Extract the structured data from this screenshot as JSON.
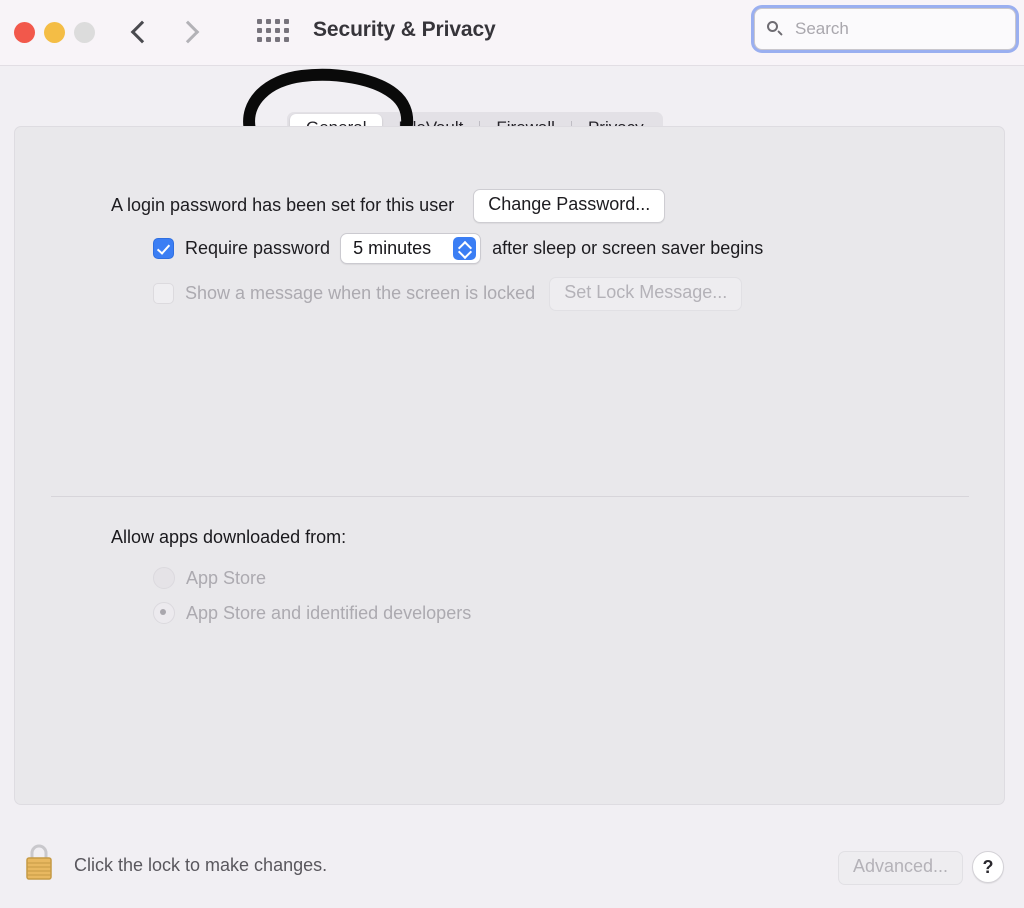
{
  "window": {
    "title": "Security & Privacy",
    "traffic_lights": [
      {
        "name": "close",
        "color": "#f2584b"
      },
      {
        "name": "minimize",
        "color": "#f4bd45"
      },
      {
        "name": "zoom",
        "color": "#dcdcdc"
      }
    ],
    "nav": {
      "back_icon": "chevron-left-icon",
      "forward_icon": "chevron-right-icon"
    },
    "grid_icon": "show-all-grid-icon"
  },
  "search": {
    "placeholder": "Search",
    "value": "",
    "icon": "search-icon",
    "focus_ring_color": "#9aaff0"
  },
  "tabs": [
    {
      "label": "General",
      "selected": true
    },
    {
      "label": "FileVault",
      "selected": false
    },
    {
      "label": "Firewall",
      "selected": false
    },
    {
      "label": "Privacy",
      "selected": false
    }
  ],
  "annotation": {
    "type": "hand-drawn-circle",
    "target": "General",
    "color": "#0a0a0a"
  },
  "general": {
    "login_password_text": "A login password has been set for this user",
    "change_password_button": "Change Password...",
    "require_password": {
      "checked": true,
      "label": "Require password",
      "delay_value": "5 minutes",
      "suffix": "after sleep or screen saver begins"
    },
    "lock_message": {
      "checked": false,
      "disabled": true,
      "label": "Show a message when the screen is locked",
      "button": "Set Lock Message..."
    },
    "allow_apps": {
      "title": "Allow apps downloaded from:",
      "disabled": true,
      "options": [
        {
          "label": "App Store",
          "selected": false
        },
        {
          "label": "App Store and identified developers",
          "selected": true
        }
      ]
    }
  },
  "footer": {
    "lock_icon": "closed-padlock-icon",
    "lock_text": "Click the lock to make changes.",
    "advanced_button": "Advanced...",
    "advanced_disabled": true,
    "help_button": "?"
  },
  "colors": {
    "accent": "#3b7ef4",
    "titlebar_bg": "#f8f4f8",
    "window_bg": "#f1eff3",
    "panel_bg": "#e9e8eb"
  }
}
